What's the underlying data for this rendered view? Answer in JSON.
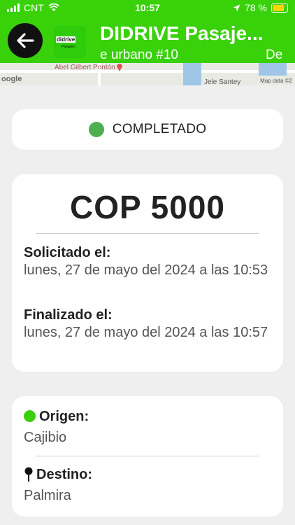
{
  "status_bar": {
    "carrier": "CNT",
    "time": "10:57",
    "battery": "78 %"
  },
  "header": {
    "title": "DIDRIVE Pasaje...",
    "subtitle": "e urbano #10",
    "subtitle_overflow": "De",
    "logo_text": "didrive",
    "logo_subtext": "Pasajero",
    "accent_color": "#38d10a"
  },
  "map": {
    "street_label": "Abel Gilbert Pontón",
    "street_label_2": "Jele Santey",
    "attribution": "Map data ©2",
    "google": "oogle"
  },
  "ride": {
    "status": "COMPLETADO",
    "status_color": "#4caf50",
    "price": "COP 5000",
    "requested_label": "Solicitado el:",
    "requested_value": "lunes, 27 de mayo del 2024 a las 10:53",
    "finished_label": "Finalizado el:",
    "finished_value": "lunes, 27 de mayo del 2024 a las 10:57"
  },
  "route": {
    "origin_label": "Origen:",
    "origin_value": "Cajibio",
    "destination_label": "Destino:",
    "destination_value": "Palmira"
  },
  "icons": {
    "back": "arrow-left-icon",
    "origin": "green-dot-icon",
    "destination": "map-pin-icon"
  }
}
